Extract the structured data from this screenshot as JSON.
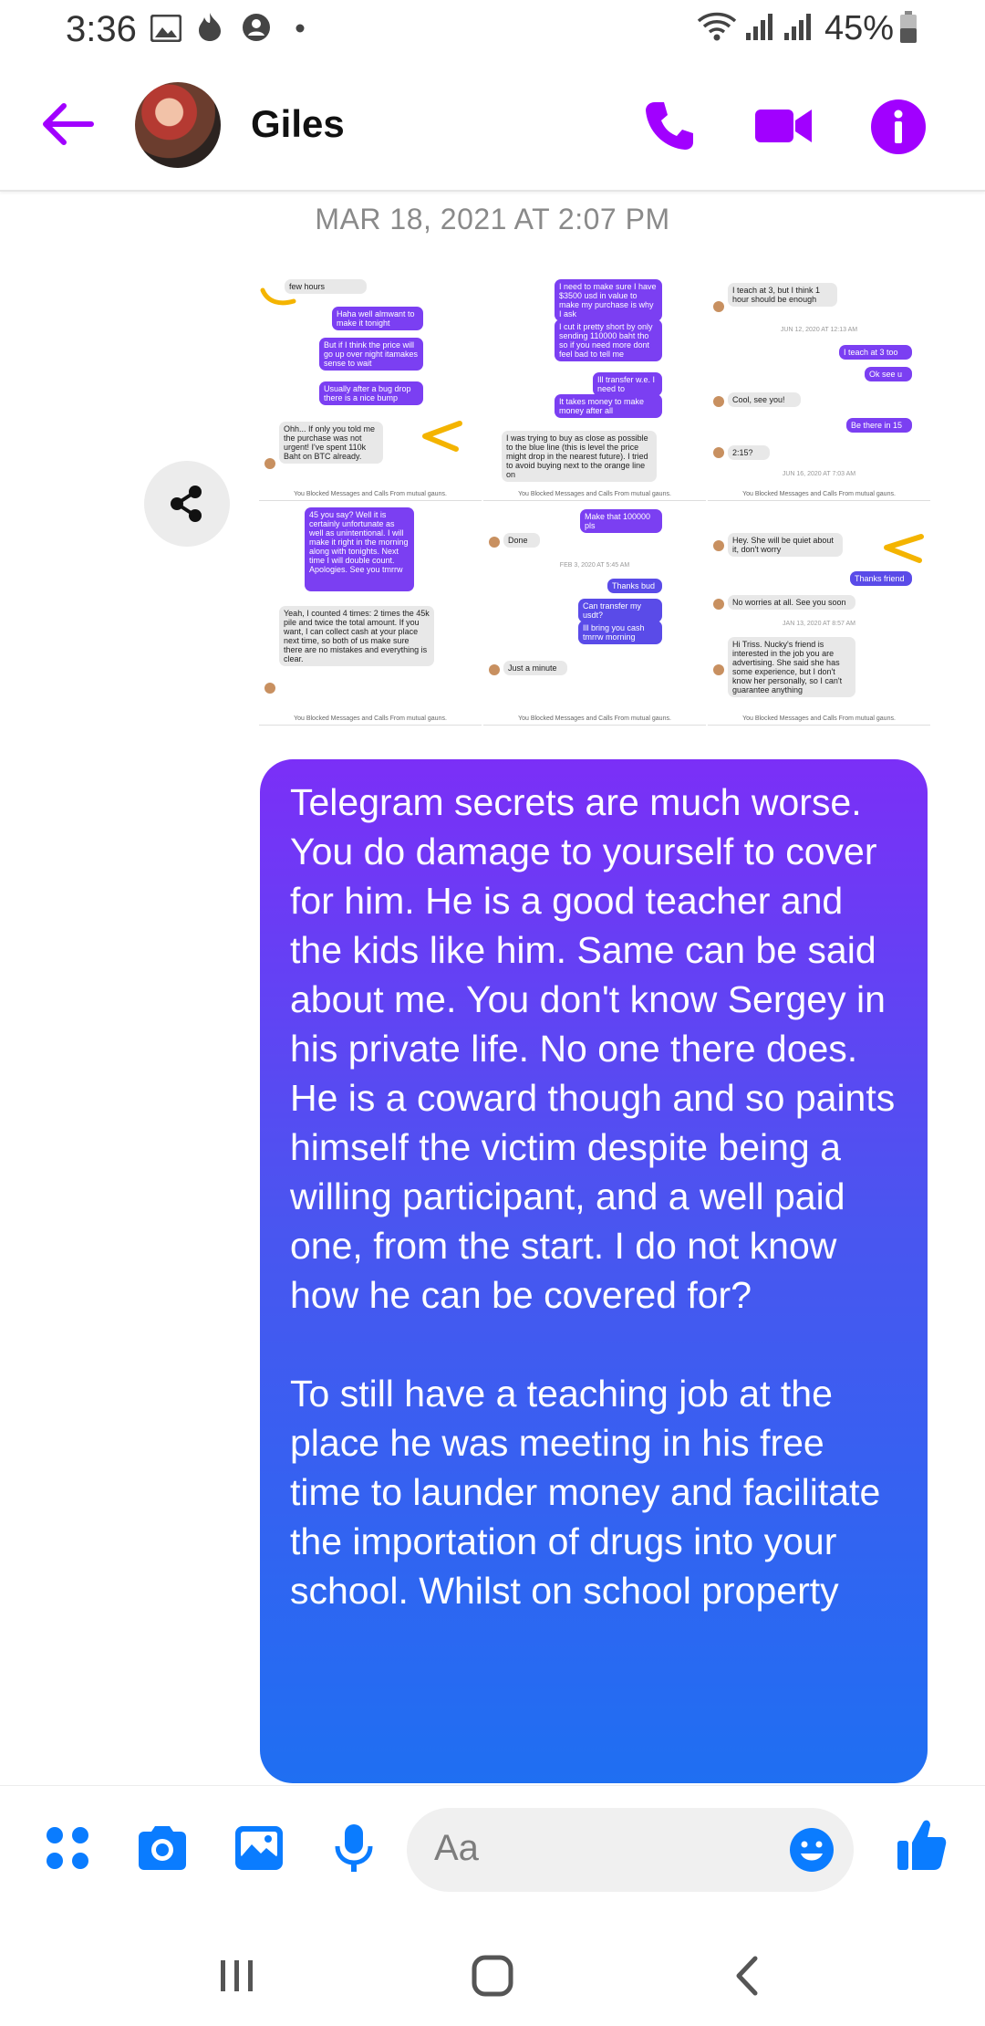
{
  "status_bar": {
    "time": "3:36",
    "battery": "45%",
    "icons": [
      "gallery-icon",
      "tinder-flame-icon",
      "account-icon",
      "dot-icon",
      "wifi-icon",
      "signal-icon",
      "signal-icon",
      "battery-icon"
    ]
  },
  "header": {
    "contact_name": "Giles",
    "accent": "#a100ff"
  },
  "conversation": {
    "timestamp": "MAR 18, 2021 AT 2:07 PM",
    "shared_image": {
      "panels": [
        {
          "messages": [
            {
              "from": "them",
              "text": "few hours"
            },
            {
              "from": "me",
              "text": "Haha well almwant to make it tonight"
            },
            {
              "from": "me",
              "text": "But if I think the price will go up over night itamakes sense to wait"
            },
            {
              "from": "me",
              "text": "Usually after a bug drop there is a nice bump"
            },
            {
              "from": "them",
              "text": "Ohh... If only you told me the purchase was not urgent! I've spent 110k Baht on BTC already."
            }
          ],
          "footer": "You Blocked Messages and Calls From mutual gauns."
        },
        {
          "messages": [
            {
              "from": "me",
              "text": "I need to make sure I have $3500 usd in value to make my purchase is why I ask"
            },
            {
              "from": "me",
              "text": "I cut it pretty short by only sending 110000 baht tho so if you need more dont feel bad to tell me"
            },
            {
              "from": "me",
              "text": "Ill transfer w.e. I need to"
            },
            {
              "from": "me",
              "text": "It takes money to make money after all"
            },
            {
              "from": "them",
              "text": "I was trying to buy as close as possible to the blue line (this is level the price might drop in the nearest future). I tried to avoid buying next to the orange line on"
            }
          ],
          "footer": "You Blocked Messages and Calls From mutual gauns."
        },
        {
          "messages": [
            {
              "from": "them",
              "text": "I teach at 3, but I think 1 hour should be enough"
            },
            {
              "from": "me",
              "text": "I teach at 3 too"
            },
            {
              "from": "me",
              "text": "Ok see u"
            },
            {
              "from": "them",
              "text": "Cool, see you!"
            },
            {
              "from": "me",
              "text": "Be there in 15"
            },
            {
              "from": "them",
              "text": "2:15?"
            }
          ],
          "date": "JUN 12, 2020 AT 12:13 AM",
          "date2": "JUN 16, 2020 AT 7:03 AM",
          "footer": "You Blocked Messages and Calls From mutual gauns."
        },
        {
          "messages": [
            {
              "from": "me",
              "text": "45 you say? Well it is certainly unfortunate as well as unintentional. I will make it right in the morning along with tonights. Next time I will double count. Apologies. See you tmrrw"
            },
            {
              "from": "them",
              "text": "Yeah, I counted 4 times: 2 times the 45k pile and twice the total amount. If you want, I can collect cash at your place next time, so both of us make sure there are no mistakes and everything is clear."
            }
          ],
          "footer": "You Blocked Messages and Calls From mutual gauns."
        },
        {
          "messages": [
            {
              "from": "me",
              "text": "Make that 100000 pls"
            },
            {
              "from": "them",
              "text": "Done"
            },
            {
              "from": "me",
              "text": "Thanks bud"
            },
            {
              "from": "me",
              "text": "Can transfer my usdt?"
            },
            {
              "from": "me",
              "text": "Ill bring you cash tmrrw morning"
            },
            {
              "from": "them",
              "text": "Just a minute"
            }
          ],
          "date": "FEB 3, 2020 AT 5:45 AM",
          "footer": "You Blocked Messages and Calls From mutual gauns."
        },
        {
          "messages": [
            {
              "from": "them",
              "text": "Hey. She will be quiet about it, don't worry"
            },
            {
              "from": "me",
              "text": "Thanks friend"
            },
            {
              "from": "them",
              "text": "No worries at all. See you soon"
            },
            {
              "from": "them",
              "text": "Hi Triss. Nucky's friend is interested in the job you are advertising. She said she has some experience, but I don't know her personally, so I can't guarantee anything"
            }
          ],
          "date": "JAN 13, 2020 AT 8:57 AM",
          "footer": "You Blocked Messages and Calls From mutual gauns."
        }
      ]
    },
    "sent_message": {
      "paragraphs": [
        "Telegram secrets are much worse. You do damage to yourself to cover for him. He is a good teacher and the kids like him. Same can be said about me. You don't know Sergey in his private life. No one there does. He is a coward though and so paints himself the victim despite being a willing participant, and a well paid one, from the start. I do not know how he can be covered for?",
        "To still have a teaching job at the place he was meeting in his free time to launder money and facilitate the importation of drugs into your school. Whilst on school property"
      ],
      "gradient_top": "#7b2ff7",
      "gradient_bottom": "#1f6ff2"
    }
  },
  "composer": {
    "placeholder": "Aa",
    "accent": "#0a7cff"
  },
  "nav_bar": {
    "icons": [
      "recent-apps-icon",
      "home-icon",
      "back-icon"
    ]
  }
}
